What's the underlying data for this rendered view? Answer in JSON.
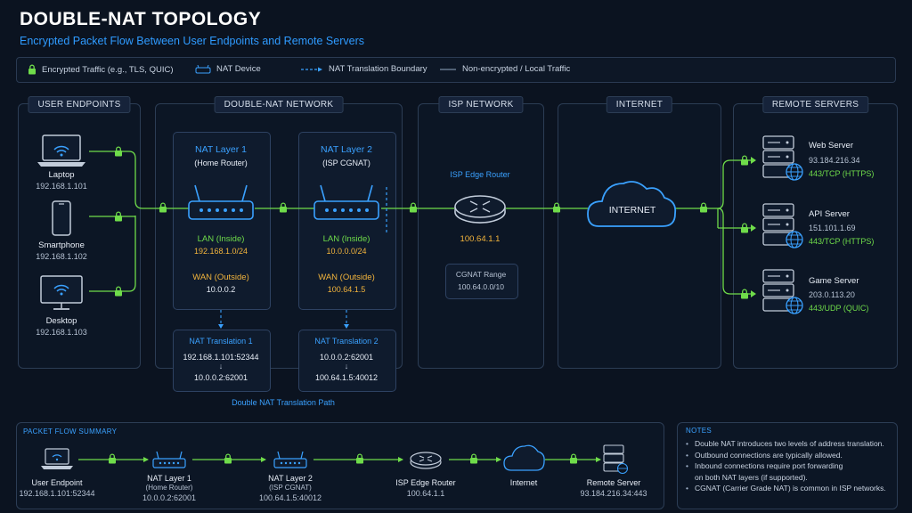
{
  "header": {
    "title": "DOUBLE-NAT TOPOLOGY",
    "subtitle": "Encrypted Packet Flow Between User Endpoints and Remote Servers"
  },
  "legend": {
    "encrypted": "Encrypted Traffic (e.g., TLS, QUIC)",
    "nat_device": "NAT Device",
    "boundary": "NAT Translation Boundary",
    "local": "Non-encrypted / Local Traffic"
  },
  "panels": {
    "endpoints": "USER ENDPOINTS",
    "double_nat": "DOUBLE-NAT NETWORK",
    "isp": "ISP NETWORK",
    "internet": "INTERNET",
    "servers": "REMOTE SERVERS"
  },
  "endpoints": [
    {
      "name": "Laptop",
      "ip": "192.168.1.101"
    },
    {
      "name": "Smartphone",
      "ip": "192.168.1.102"
    },
    {
      "name": "Desktop",
      "ip": "192.168.1.103"
    }
  ],
  "nat1": {
    "title": "NAT Layer 1",
    "sub": "(Home Router)",
    "lan_label": "LAN (Inside)",
    "lan_value": "192.168.1.0/24",
    "wan_label": "WAN (Outside)",
    "wan_value": "10.0.0.2"
  },
  "nat2": {
    "title": "NAT Layer 2",
    "sub": "(ISP CGNAT)",
    "lan_label": "LAN (Inside)",
    "lan_value": "10.0.0.0/24",
    "wan_label": "WAN (Outside)",
    "wan_value": "100.64.1.5"
  },
  "trans1": {
    "title": "NAT Translation 1",
    "from": "192.168.1.101:52344",
    "to": "10.0.0.2:62001"
  },
  "trans2": {
    "title": "NAT Translation 2",
    "from": "10.0.0.2:62001",
    "to": "100.64.1.5:40012"
  },
  "translation_path": "Double NAT Translation Path",
  "isp": {
    "router": "ISP Edge Router",
    "ip": "100.64.1.1",
    "cgnat_label": "CGNAT Range",
    "cgnat_value": "100.64.0.0/10"
  },
  "internet_label": "INTERNET",
  "servers": [
    {
      "name": "Web Server",
      "ip": "93.184.216.34",
      "port": "443/TCP (HTTPS)"
    },
    {
      "name": "API Server",
      "ip": "151.101.1.69",
      "port": "443/TCP (HTTPS)"
    },
    {
      "name": "Game Server",
      "ip": "203.0.113.20",
      "port": "443/UDP (QUIC)"
    }
  ],
  "summary": {
    "title": "PACKET FLOW SUMMARY",
    "steps": [
      {
        "name": "User Endpoint",
        "sub": "",
        "ip": "192.168.1.101:52344"
      },
      {
        "name": "NAT Layer 1",
        "sub": "(Home Router)",
        "ip": "10.0.0.2:62001"
      },
      {
        "name": "NAT Layer 2",
        "sub": "(ISP CGNAT)",
        "ip": "100.64.1.5:40012"
      },
      {
        "name": "ISP Edge Router",
        "sub": "",
        "ip": "100.64.1.1"
      },
      {
        "name": "Internet",
        "sub": "",
        "ip": ""
      },
      {
        "name": "Remote Server",
        "sub": "",
        "ip": "93.184.216.34:443"
      }
    ]
  },
  "notes": {
    "title": "NOTES",
    "items": [
      "Double NAT introduces two levels of address translation.",
      "Outbound connections are typically allowed.",
      "Inbound connections require port forwarding",
      "on both NAT layers (if supported).",
      "CGNAT (Carrier Grade NAT) is common in ISP networks."
    ]
  },
  "colors": {
    "background": "#0b1320",
    "encrypted_green": "#6fdc4a",
    "accent_blue": "#3aa1ff",
    "wan_yellow": "#f2b43c"
  }
}
